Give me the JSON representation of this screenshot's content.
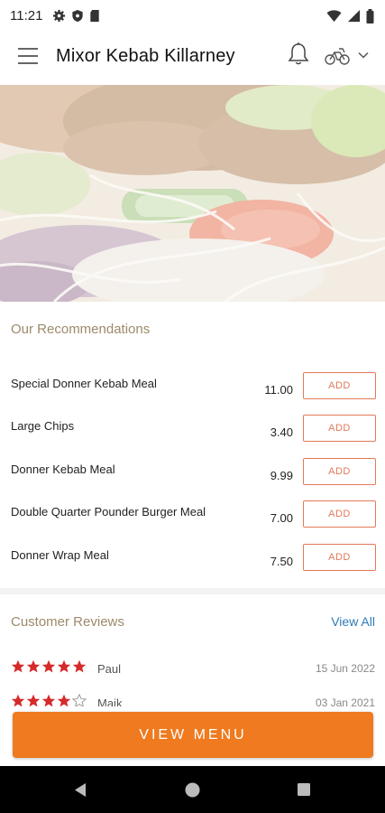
{
  "status_bar": {
    "time": "11:21",
    "left_icons": [
      "gear-icon",
      "shield-icon",
      "sd-card-icon"
    ],
    "right_icons": [
      "wifi-icon",
      "signal-icon",
      "battery-icon"
    ]
  },
  "app_bar": {
    "title": "Mixor Kebab Killarney",
    "icons": [
      "menu-icon",
      "bell-icon",
      "delivery-bike-icon",
      "chevron-down-icon"
    ]
  },
  "recommendations": {
    "title": "Our Recommendations",
    "add_label": "ADD",
    "items": [
      {
        "name": "Special Donner Kebab Meal",
        "price": "11.00"
      },
      {
        "name": "Large Chips",
        "price": "3.40"
      },
      {
        "name": "Donner Kebab Meal",
        "price": "9.99"
      },
      {
        "name": "Double Quarter Pounder Burger Meal",
        "price": "7.00"
      },
      {
        "name": "Donner Wrap Meal",
        "price": "7.50"
      }
    ]
  },
  "reviews": {
    "title": "Customer Reviews",
    "view_all": "View All",
    "items": [
      {
        "name": "Paul",
        "date": "15 Jun 2022",
        "rating": 5
      },
      {
        "name": "Maik",
        "date": "03 Jan 2021",
        "rating": 4
      }
    ]
  },
  "cta": {
    "label": "VIEW MENU"
  },
  "colors": {
    "accent": "#ef7a1f",
    "add_border": "#e2795a",
    "section_title": "#9d8a6a",
    "link": "#2d7ab8",
    "star": "#d62a2a"
  }
}
